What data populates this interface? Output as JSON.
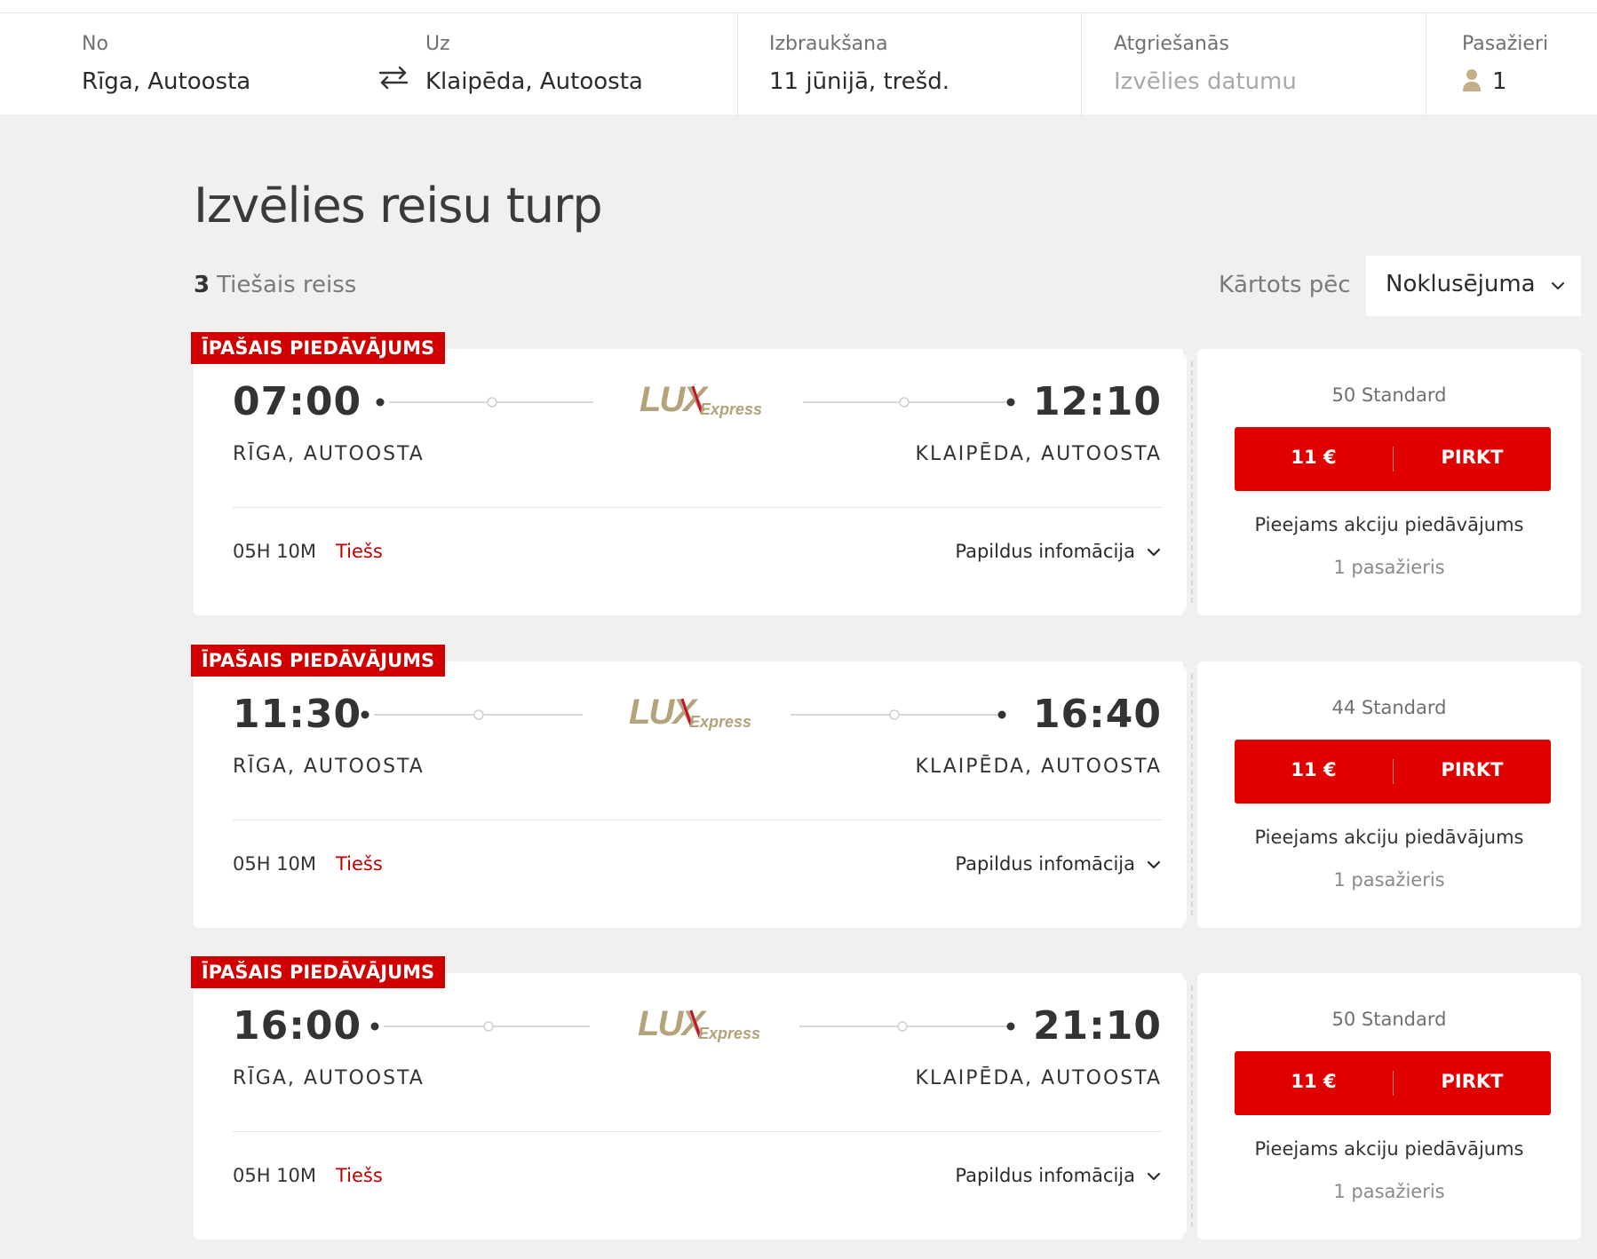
{
  "search": {
    "from_label": "No",
    "from_value": "Rīga, Autoosta",
    "to_label": "Uz",
    "to_value": "Klaipēda, Autoosta",
    "depart_label": "Izbraukšana",
    "depart_value": "11 jūnijā, trešd.",
    "return_label": "Atgriešanās",
    "return_placeholder": "Izvēlies datumu",
    "passengers_label": "Pasažieri",
    "passengers_value": "1"
  },
  "page": {
    "title": "Izvēlies reisu turp",
    "count_number": "3",
    "count_label": "Tiešais reiss",
    "sort_label": "Kārtots pēc",
    "sort_value": "Noklusējuma"
  },
  "results": [
    {
      "badge": "ĪPAŠAIS PIEDĀVĀJUMS",
      "depart_time": "07:00",
      "arrive_time": "12:10",
      "from_station": "RĪGA, AUTOOSTA",
      "to_station": "KLAIPĒDA, AUTOOSTA",
      "carrier": "LUX Express",
      "duration": "05H 10M",
      "direct": "Tiešs",
      "more_info": "Papildus infomācija",
      "seats": "50 Standard",
      "price": "11 €",
      "buy": "PIRKT",
      "promo": "Pieejams akciju piedāvājums",
      "passengers": "1 pasažieris"
    },
    {
      "badge": "ĪPAŠAIS PIEDĀVĀJUMS",
      "depart_time": "11:30",
      "arrive_time": "16:40",
      "from_station": "RĪGA, AUTOOSTA",
      "to_station": "KLAIPĒDA, AUTOOSTA",
      "carrier": "LUX Express",
      "duration": "05H 10M",
      "direct": "Tiešs",
      "more_info": "Papildus infomācija",
      "seats": "44 Standard",
      "price": "11 €",
      "buy": "PIRKT",
      "promo": "Pieejams akciju piedāvājums",
      "passengers": "1 pasažieris"
    },
    {
      "badge": "ĪPAŠAIS PIEDĀVĀJUMS",
      "depart_time": "16:00",
      "arrive_time": "21:10",
      "from_station": "RĪGA, AUTOOSTA",
      "to_station": "KLAIPĒDA, AUTOOSTA",
      "carrier": "LUX Express",
      "duration": "05H 10M",
      "direct": "Tiešs",
      "more_info": "Papildus infomācija",
      "seats": "50 Standard",
      "price": "11 €",
      "buy": "PIRKT",
      "promo": "Pieejams akciju piedāvājums",
      "passengers": "1 pasažieris"
    }
  ],
  "colors": {
    "accent": "#e00000",
    "badge": "#d00000",
    "direct": "#c00000",
    "logo_gold": "#b3a27a",
    "logo_red": "#c8102e",
    "background": "#f0f0f0"
  },
  "icons": {
    "swap": "swap-arrows-icon",
    "passenger": "person-icon",
    "sort": "chevron-down-icon",
    "more": "chevron-down-icon"
  }
}
